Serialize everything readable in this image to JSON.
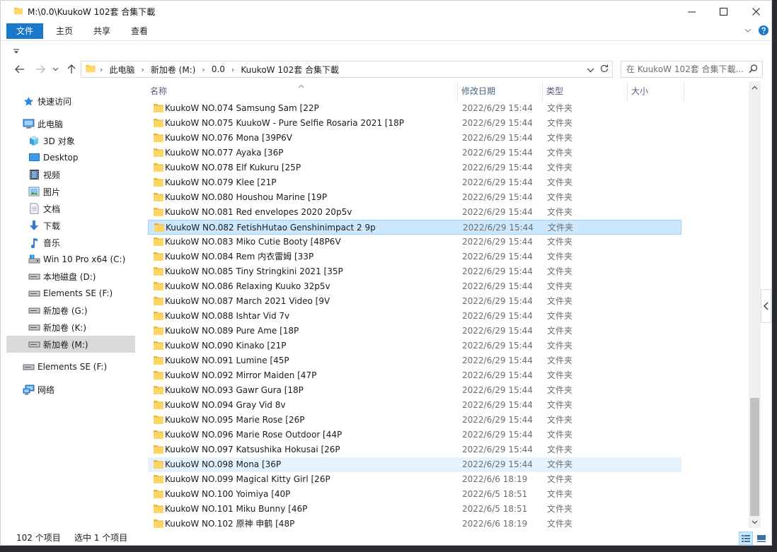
{
  "window": {
    "title": "M:\\0.0\\KuukoW 102套 合集下載",
    "accent": "#1979ca"
  },
  "ribbon": {
    "tabs": [
      "文件",
      "主页",
      "共享",
      "查看"
    ]
  },
  "address": {
    "crumbs": [
      "此电脑",
      "新加卷 (M:)",
      "0.0",
      "KuukoW 102套 合集下載"
    ]
  },
  "search": {
    "placeholder": "在 KuukoW 102套 合集下載..."
  },
  "sidebar": {
    "items": [
      {
        "label": "快速访问",
        "icon": "star-icon"
      },
      {
        "label": "此电脑",
        "icon": "computer-icon"
      },
      {
        "label": "3D 对象",
        "icon": "cube-icon"
      },
      {
        "label": "Desktop",
        "icon": "desktop-icon"
      },
      {
        "label": "视频",
        "icon": "video-icon"
      },
      {
        "label": "图片",
        "icon": "picture-icon"
      },
      {
        "label": "文档",
        "icon": "document-icon"
      },
      {
        "label": "下载",
        "icon": "download-icon"
      },
      {
        "label": "音乐",
        "icon": "music-icon"
      },
      {
        "label": "Win 10 Pro x64 (C:)",
        "icon": "windows-drive-icon"
      },
      {
        "label": "本地磁盘 (D:)",
        "icon": "drive-icon"
      },
      {
        "label": "Elements SE (F:)",
        "icon": "drive-icon"
      },
      {
        "label": "新加卷 (G:)",
        "icon": "drive-icon"
      },
      {
        "label": "新加卷 (K:)",
        "icon": "drive-icon"
      },
      {
        "label": "新加卷 (M:)",
        "icon": "drive-icon"
      },
      {
        "label": "Elements SE (F:)",
        "icon": "drive-icon"
      },
      {
        "label": "网络",
        "icon": "network-icon"
      }
    ]
  },
  "columns": {
    "name": "名称",
    "date": "修改日期",
    "type": "类型",
    "size": "大小"
  },
  "files": [
    {
      "name": "KuukoW NO.074 Samsung Sam [22P",
      "date": "2022/6/29 15:44",
      "type": "文件夹"
    },
    {
      "name": "KuukoW NO.075 KuukoW - Pure Selfie Rosaria 2021 [18P",
      "date": "2022/6/29 15:44",
      "type": "文件夹"
    },
    {
      "name": "KuukoW NO.076 Mona [39P6V",
      "date": "2022/6/29 15:44",
      "type": "文件夹"
    },
    {
      "name": "KuukoW NO.077 Ayaka [36P",
      "date": "2022/6/29 15:44",
      "type": "文件夹"
    },
    {
      "name": "KuukoW NO.078 Elf Kukuru [25P",
      "date": "2022/6/29 15:44",
      "type": "文件夹"
    },
    {
      "name": "KuukoW NO.079 Klee [21P",
      "date": "2022/6/29 15:44",
      "type": "文件夹"
    },
    {
      "name": "KuukoW NO.080 Houshou Marine [19P",
      "date": "2022/6/29 15:44",
      "type": "文件夹"
    },
    {
      "name": "KuukoW NO.081 Red envelopes 2020 20p5v",
      "date": "2022/6/29 15:44",
      "type": "文件夹"
    },
    {
      "name": "KuukoW NO.082 FetishHutao Genshinimpact 2 9p",
      "date": "2022/6/29 15:44",
      "type": "文件夹"
    },
    {
      "name": "KuukoW NO.083 Miko Cutie Booty [48P6V",
      "date": "2022/6/29 15:44",
      "type": "文件夹"
    },
    {
      "name": "KuukoW NO.084 Rem 内衣雷姆 [33P",
      "date": "2022/6/29 15:44",
      "type": "文件夹"
    },
    {
      "name": "KuukoW NO.085 Tiny Stringkini 2021 [35P",
      "date": "2022/6/29 15:44",
      "type": "文件夹"
    },
    {
      "name": "KuukoW NO.086 Relaxing Kuuko 32p5v",
      "date": "2022/6/29 15:44",
      "type": "文件夹"
    },
    {
      "name": "KuukoW NO.087 March 2021 Video [9V",
      "date": "2022/6/29 15:44",
      "type": "文件夹"
    },
    {
      "name": "KuukoW NO.088 Ishtar Vid 7v",
      "date": "2022/6/29 15:44",
      "type": "文件夹"
    },
    {
      "name": "KuukoW NO.089 Pure Ame [18P",
      "date": "2022/6/29 15:44",
      "type": "文件夹"
    },
    {
      "name": "KuukoW NO.090 Kinako [21P",
      "date": "2022/6/29 15:44",
      "type": "文件夹"
    },
    {
      "name": "KuukoW NO.091 Lumine [45P",
      "date": "2022/6/29 15:44",
      "type": "文件夹"
    },
    {
      "name": "KuukoW NO.092 Mirror Maiden [47P",
      "date": "2022/6/29 15:44",
      "type": "文件夹"
    },
    {
      "name": "KuukoW NO.093 Gawr Gura [18P",
      "date": "2022/6/29 15:44",
      "type": "文件夹"
    },
    {
      "name": "KuukoW NO.094 Gray Vid 8v",
      "date": "2022/6/29 15:44",
      "type": "文件夹"
    },
    {
      "name": "KuukoW NO.095 Marie Rose [26P",
      "date": "2022/6/29 15:44",
      "type": "文件夹"
    },
    {
      "name": "KuukoW NO.096 Marie Rose Outdoor [44P",
      "date": "2022/6/29 15:44",
      "type": "文件夹"
    },
    {
      "name": "KuukoW NO.097 Katsushika Hokusai [26P",
      "date": "2022/6/29 15:44",
      "type": "文件夹"
    },
    {
      "name": "KuukoW NO.098 Mona [36P",
      "date": "2022/6/29 15:44",
      "type": "文件夹"
    },
    {
      "name": "KuukoW NO.099 Magical Kitty Girl [26P",
      "date": "2022/6/6 18:19",
      "type": "文件夹"
    },
    {
      "name": "KuukoW NO.100 Yoimiya [40P",
      "date": "2022/6/5 18:51",
      "type": "文件夹"
    },
    {
      "name": "KuukoW NO.101 Miku Bunny [46P",
      "date": "2022/6/5 18:51",
      "type": "文件夹"
    },
    {
      "name": "KuukoW NO.102 原神 申鹤 [48P",
      "date": "2022/6/6 18:19",
      "type": "文件夹"
    }
  ],
  "selected_file": "KuukoW NO.082 FetishHutao Genshinimpact 2 9p",
  "hovered_file": "KuukoW NO.098 Mona [36P",
  "status": {
    "count": "102 个项目",
    "selection": "选中 1 个项目"
  }
}
